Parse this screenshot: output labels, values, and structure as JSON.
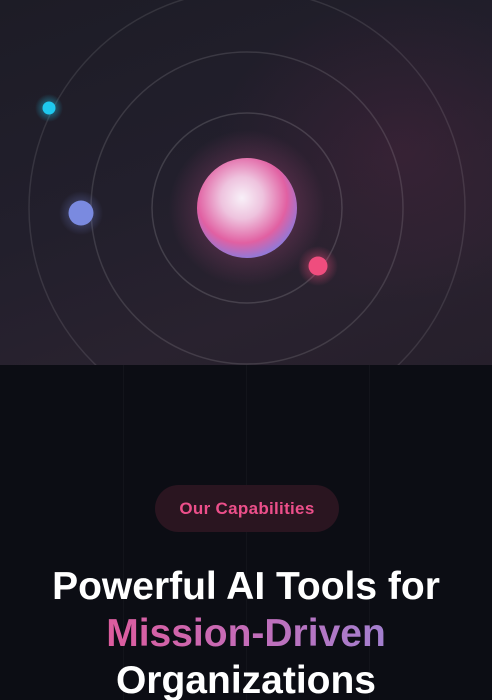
{
  "hero": {
    "center_colors": [
      "#f5eaf4",
      "#e45a9c",
      "#8f7fd8"
    ],
    "dot_colors": {
      "cyan": "#1fc8ee",
      "periwinkle": "#7a8ae0",
      "pink": "#ef4d7e"
    }
  },
  "capabilities": {
    "badge_label": "Our Capabilities",
    "heading_line1": "Powerful AI Tools for",
    "heading_highlight": "Mission-Driven",
    "heading_line3": "Organizations",
    "accent_gradient": [
      "#f0508a",
      "#c46cb8",
      "#8a8ee0"
    ]
  }
}
